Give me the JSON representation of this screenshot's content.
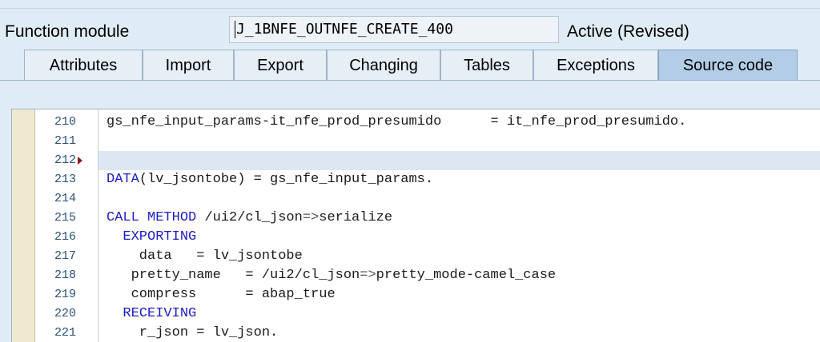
{
  "header": {
    "label": "Function module",
    "value": "J_1BNFE_OUTNFE_CREATE_400",
    "status": "Active (Revised)"
  },
  "tabs": [
    {
      "label": "Attributes",
      "active": false
    },
    {
      "label": "Import",
      "active": false
    },
    {
      "label": "Export",
      "active": false
    },
    {
      "label": "Changing",
      "active": false
    },
    {
      "label": "Tables",
      "active": false
    },
    {
      "label": "Exceptions",
      "active": false
    },
    {
      "label": "Source code",
      "active": true
    }
  ],
  "editor": {
    "current_line": "212",
    "lines": [
      {
        "num": "210",
        "text": "gs_nfe_input_params-it_nfe_prod_presumido      = it_nfe_prod_presumido."
      },
      {
        "num": "211",
        "text": ""
      },
      {
        "num": "212",
        "text": ""
      },
      {
        "num": "213",
        "text": "DATA(lv_jsontobe) = gs_nfe_input_params."
      },
      {
        "num": "214",
        "text": ""
      },
      {
        "num": "215",
        "text": "CALL METHOD /ui2/cl_json=>serialize"
      },
      {
        "num": "216",
        "text": "  EXPORTING"
      },
      {
        "num": "217",
        "text": "    data   = lv_jsontobe"
      },
      {
        "num": "218",
        "text": "   pretty_name   = /ui2/cl_json=>pretty_mode-camel_case"
      },
      {
        "num": "219",
        "text": "   compress      = abap_true"
      },
      {
        "num": "220",
        "text": "  RECEIVING"
      },
      {
        "num": "221",
        "text": "    r_json = lv_json."
      }
    ]
  },
  "colors": {
    "keyword": "#1c1cc4",
    "line_number": "#2b5278",
    "active_tab": "#b3cde6",
    "breakpoint_marker": "#8b1a1a"
  }
}
